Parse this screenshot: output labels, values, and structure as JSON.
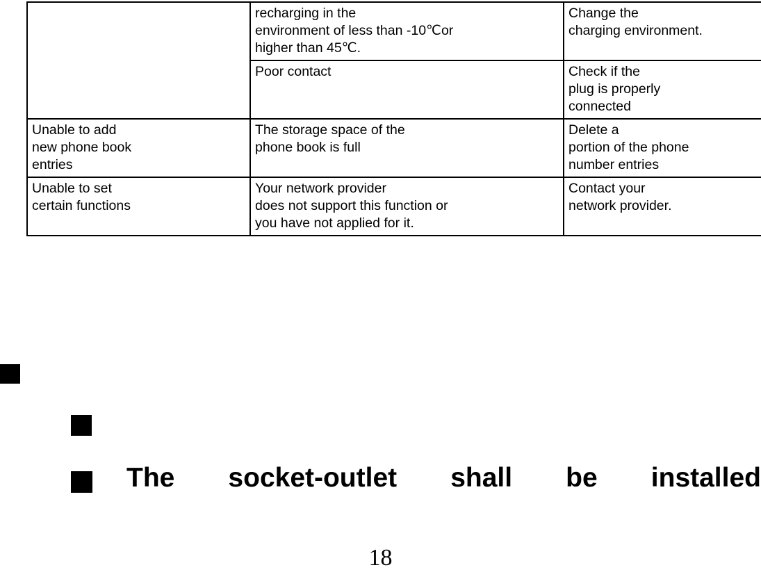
{
  "document": {
    "page_number": "18",
    "table": {
      "columns": 3,
      "rows": [
        {
          "cells": [
            {
              "lines": [],
              "rowspan": 2
            },
            {
              "lines": [
                "recharging in the",
                "environment of less than -10℃or",
                "higher than 45℃."
              ]
            },
            {
              "lines": [
                "Change the",
                "charging environment."
              ]
            }
          ]
        },
        {
          "cells": [
            {
              "lines": [
                "Poor contact"
              ]
            },
            {
              "lines": [
                "Check if the",
                "plug is properly",
                "connected"
              ]
            }
          ]
        },
        {
          "cells": [
            {
              "lines": [
                "Unable to add",
                "new phone book",
                "entries"
              ]
            },
            {
              "lines": [
                "The storage space of the",
                "phone book is full"
              ]
            },
            {
              "lines": [
                "Delete a",
                "portion of the phone",
                "number entries"
              ]
            }
          ]
        },
        {
          "cells": [
            {
              "lines": [
                "Unable to set",
                "certain functions"
              ]
            },
            {
              "lines": [
                "Your network provider",
                "does not support this function or",
                "you have not applied for it."
              ]
            },
            {
              "lines": [
                "Contact your",
                "network provider."
              ]
            }
          ]
        }
      ]
    },
    "notes": [
      {
        "bullet": "square-bullet",
        "text": ""
      },
      {
        "bullet": "square-bullet",
        "text": ""
      },
      {
        "bullet": "square-bullet",
        "text": "The socket-outlet shall be installed"
      }
    ]
  }
}
